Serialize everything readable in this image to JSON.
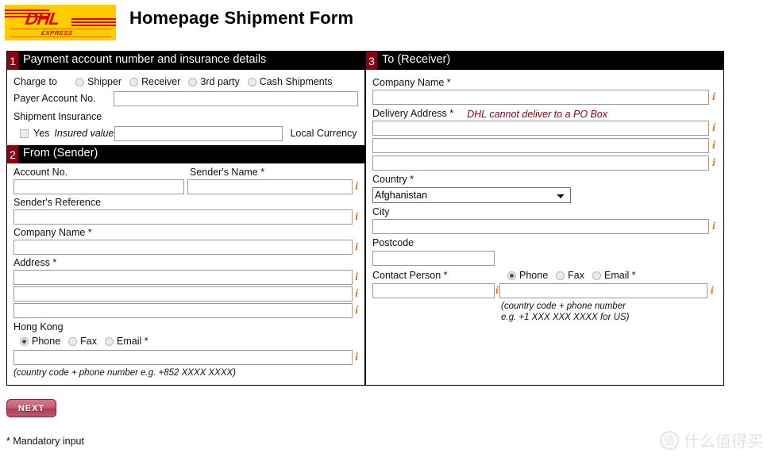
{
  "header": {
    "logo_wordmark": "DHL",
    "logo_sub": "EXPRESS",
    "title": "Homepage Shipment Form"
  },
  "section1": {
    "number": "1",
    "title": "Payment account number and insurance details",
    "charge_to_label": "Charge to",
    "charge_options": [
      {
        "label": "Shipper",
        "selected": false
      },
      {
        "label": "Receiver",
        "selected": false
      },
      {
        "label": "3rd party",
        "selected": false
      },
      {
        "label": "Cash Shipments",
        "selected": false
      }
    ],
    "payer_account_label": "Payer Account No.",
    "payer_account_value": "",
    "shipment_insurance_label": "Shipment Insurance",
    "insurance_yes_label": "Yes",
    "insurance_yes_checked": false,
    "insured_value_label": "Insured value",
    "insured_value": "",
    "local_currency_label": "Local Currency"
  },
  "section2": {
    "number": "2",
    "title": "From (Sender)",
    "account_no_label": "Account No.",
    "account_no_value": "",
    "senders_name_label": "Sender's Name *",
    "senders_name_value": "",
    "senders_reference_label": "Sender's Reference",
    "senders_reference_value": "",
    "company_name_label": "Company Name *",
    "company_name_value": "",
    "address_label": "Address *",
    "address_line1": "",
    "address_line2": "",
    "address_line3": "",
    "country_label": "Hong Kong",
    "contact_options": [
      {
        "label": "Phone",
        "selected": true
      },
      {
        "label": "Fax",
        "selected": false
      },
      {
        "label": "Email *",
        "selected": false
      }
    ],
    "contact_value": "",
    "contact_hint": "(country code + phone number e.g. +852 XXXX XXXX)"
  },
  "section3": {
    "number": "3",
    "title": "To (Receiver)",
    "company_name_label": "Company Name *",
    "company_name_value": "",
    "delivery_address_label": "Delivery Address *",
    "delivery_address_warning": "DHL cannot deliver to a PO Box",
    "delivery_line1": "",
    "delivery_line2": "",
    "delivery_line3": "",
    "country_label": "Country *",
    "country_selected": "Afghanistan",
    "city_label": "City",
    "city_value": "",
    "postcode_label": "Postcode",
    "postcode_value": "",
    "contact_person_label": "Contact Person *",
    "contact_person_value": "",
    "contact_options": [
      {
        "label": "Phone",
        "selected": true
      },
      {
        "label": "Fax",
        "selected": false
      },
      {
        "label": "Email *",
        "selected": false
      }
    ],
    "contact_value": "",
    "contact_hint_line1": "(country code + phone number",
    "contact_hint_line2": "e.g. +1 XXX XXX XXXX for US)"
  },
  "footer": {
    "next_label": "NEXT",
    "mandatory_note": "* Mandatory input",
    "watermark_mark": "值",
    "watermark_text": "什么值得买"
  },
  "colors": {
    "dhl_yellow": "#FFCC00",
    "dhl_red": "#D40511",
    "section_badge": "#8B0012",
    "section_header_bg": "#000000",
    "info_icon": "#F07000",
    "warning_text": "#8B0012"
  }
}
